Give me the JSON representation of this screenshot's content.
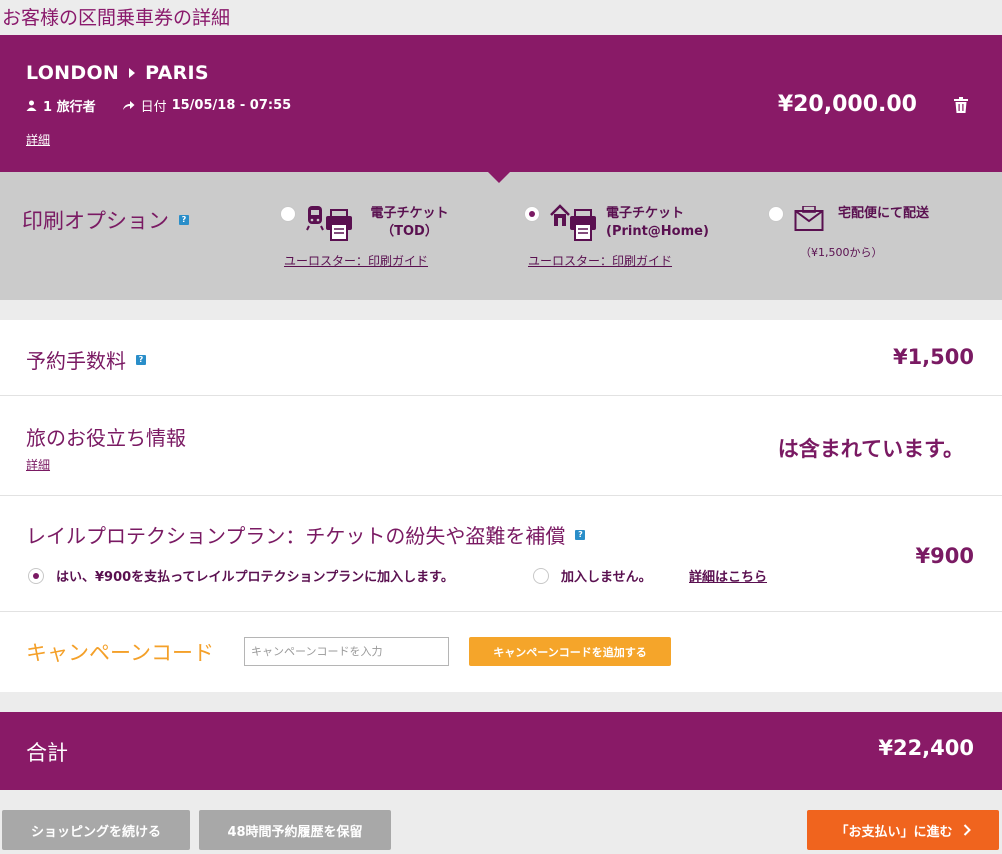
{
  "page": {
    "title": "お客様の区間乗車券の詳細"
  },
  "journey": {
    "origin": "LONDON",
    "destination": "PARIS",
    "travellers": "1 旅行者",
    "date_label": "日付",
    "date_value": "15/05/18 - 07:55",
    "detail_link": "詳細",
    "price": "¥20,000.00"
  },
  "print_options": {
    "title": "印刷オプション",
    "help": "?",
    "options": [
      {
        "label_line1": "電子チケット",
        "label_line2": "（TOD）",
        "guide": "ユーロスター：印刷ガイド",
        "selected": false,
        "icon": "train-printer-icon"
      },
      {
        "label_line1": "電子チケット",
        "label_line2": "(Print@Home)",
        "guide": "ユーロスター：印刷ガイド",
        "selected": true,
        "icon": "home-printer-icon"
      },
      {
        "label_line1": "宅配便にて配送",
        "sub": "（¥1,500から）",
        "selected": false,
        "icon": "envelope-icon"
      }
    ]
  },
  "booking_fee": {
    "title": "予約手数料",
    "help": "?",
    "amount": "¥1,500"
  },
  "travel_info": {
    "title": "旅のお役立ち情報",
    "detail_link": "詳細",
    "status": "は含まれています。"
  },
  "protection": {
    "title": "レイルプロテクションプラン：チケットの紛失や盗難を補償",
    "help": "?",
    "yes_label": "はい、¥900を支払ってレイルプロテクションプランに加入します。",
    "no_label": "加入しません。",
    "detail_link": "詳細はこちら",
    "amount": "¥900",
    "selected": "yes"
  },
  "campaign": {
    "title": "キャンペーンコード",
    "placeholder": "キャンペーンコードを入力",
    "button": "キャンペーンコードを追加する"
  },
  "total": {
    "label": "合計",
    "amount": "¥22,400"
  },
  "footer": {
    "continue_shopping": "ショッピングを続ける",
    "save_booking": "48時間予約履歴を保留",
    "checkout": "「お支払い」に進む"
  },
  "colors": {
    "brand": "#891a67",
    "accent": "#f5a52a",
    "checkout": "#f0641e"
  }
}
